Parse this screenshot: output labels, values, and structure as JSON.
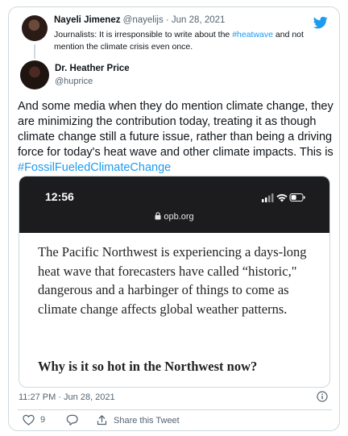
{
  "quoted": {
    "name": "Nayeli Jimenez",
    "meta": " @nayelijs · Jun 28, 2021",
    "text_before": "Journalists: It is irresponsible to write about the ",
    "hashtag": "#heatwave",
    "text_after": " and not mention the climate crisis even once."
  },
  "author": {
    "name": "Dr. Heather Price",
    "handle": "@huprice"
  },
  "tweet": {
    "text": "And some media when they do mention climate change, they are minimizing the contribution today, treating it as though climate change still a future issue, rather than being a driving force for today's heat wave and other climate impacts. This is ",
    "hashtag": "#FossilFueledClimateChange"
  },
  "screenshot": {
    "time": "12:56",
    "url": "opb.org",
    "article_text": "The Pacific Northwest is experiencing a days-long heat wave that forecasters have called “historic,\" dangerous and a harbinger of things to come as climate change affects global weather patterns.",
    "article_heading": "Why is it so hot in the Northwest now?"
  },
  "footer": {
    "timestamp": "11:27 PM · Jun 28, 2021",
    "like_count": "9",
    "share_label": "Share this Tweet"
  },
  "colors": {
    "accent": "#1d9bf0",
    "like": "#536471"
  },
  "icons": [
    "twitter-bird-icon",
    "lock-icon",
    "signal-icon",
    "wifi-icon",
    "battery-icon",
    "info-icon",
    "heart-icon",
    "reply-icon",
    "share-icon"
  ]
}
